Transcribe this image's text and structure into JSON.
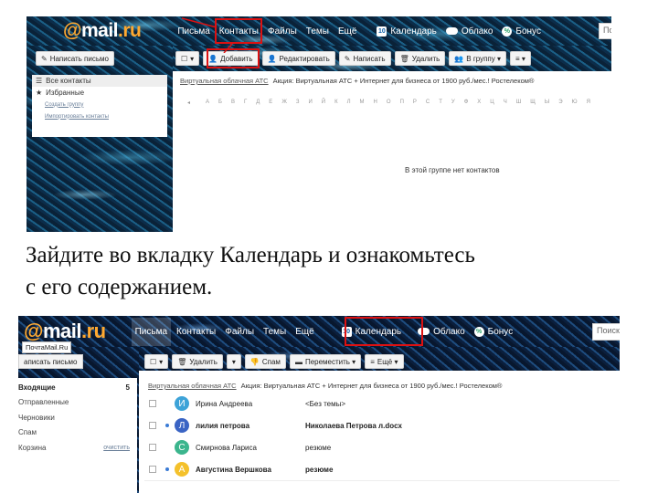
{
  "shot1": {
    "logo": {
      "at": "@",
      "main": "mail",
      "ru": ".ru"
    },
    "nav": [
      "Письма",
      "Контакты",
      "Файлы",
      "Темы",
      "Ещё"
    ],
    "nav_right": [
      {
        "label": "Календарь",
        "icon": "calendar-icon",
        "glyph": "10"
      },
      {
        "label": "Облако",
        "icon": "cloud-icon"
      },
      {
        "label": "Бонус",
        "icon": "bonus-icon",
        "glyph": "%"
      }
    ],
    "search_placeholder": "По",
    "compose_button": "Написать письмо",
    "toolbar": [
      "Добавить",
      "Редактировать",
      "Написать",
      "Удалить",
      "В группу"
    ],
    "sidebar": {
      "all_contacts": "Все контакты",
      "favorites": "Избранные",
      "create_group": "Создать группу",
      "import_contacts": "Импортировать контакты"
    },
    "ad": {
      "link": "Виртуальная облачная АТС",
      "text": "Акция: Виртуальная АТС + Интернет для бизнеса от 1900 руб./мес.! Ростелеком®"
    },
    "alphabet": [
      "А",
      "Б",
      "В",
      "Г",
      "Д",
      "Е",
      "Ж",
      "З",
      "И",
      "Й",
      "К",
      "Л",
      "М",
      "Н",
      "О",
      "П",
      "Р",
      "С",
      "Т",
      "У",
      "Ф",
      "Х",
      "Ц",
      "Ч",
      "Ш",
      "Щ",
      "Ы",
      "Э",
      "Ю",
      "Я"
    ],
    "empty_text": "В этой группе нет контактов"
  },
  "caption": {
    "line1": "Зайдите во вкладку Календарь и ознакомьтесь",
    "line2": "с его содержанием."
  },
  "shot2": {
    "logo": {
      "at": "@",
      "main": "mail",
      "ru": ".ru"
    },
    "tooltip": "ПочтаMail.Ru",
    "nav": [
      "Письма",
      "Контакты",
      "Файлы",
      "Темы",
      "Ещё"
    ],
    "calendar": {
      "label": "Календарь",
      "glyph": "10"
    },
    "cloud": "Облако",
    "bonus": "Бонус",
    "search_placeholder": "Поиск",
    "compose_button": "аписать письмо",
    "toolbar": {
      "delete": "Удалить",
      "spam": "Спам",
      "move": "Переместить",
      "more": "Ещё"
    },
    "ad": {
      "link": "Виртуальная облачная АТС",
      "text": "Акция: Виртуальная АТС + Интернет для бизнеса от 1900 руб./мес.! Ростелеком®"
    },
    "folders": [
      {
        "label": "Входящие",
        "count": "5",
        "bold": true
      },
      {
        "label": "Отправленные",
        "count": ""
      },
      {
        "label": "Черновики",
        "count": ""
      },
      {
        "label": "Спам",
        "count": ""
      },
      {
        "label": "Корзина",
        "count": "очистить"
      }
    ],
    "messages": [
      {
        "initial": "И",
        "color": "#3da3d8",
        "sender": "Ирина Андреева",
        "subject": "<Без темы>",
        "unread": false
      },
      {
        "initial": "Л",
        "color": "#3a64c4",
        "sender": "лилия петрова",
        "subject": "Николаева Петрова л.docx",
        "unread": true
      },
      {
        "initial": "С",
        "color": "#3bb58d",
        "sender": "Смирнова Лариса",
        "subject": "резюме",
        "unread": false
      },
      {
        "initial": "А",
        "color": "#f4c12b",
        "sender": "Августина Вершкова",
        "subject": "резюме",
        "unread": true
      }
    ]
  },
  "colors": {
    "highlight": "#dd1111",
    "logo_orange": "#ffa930",
    "link_blue": "#6a7f99"
  }
}
